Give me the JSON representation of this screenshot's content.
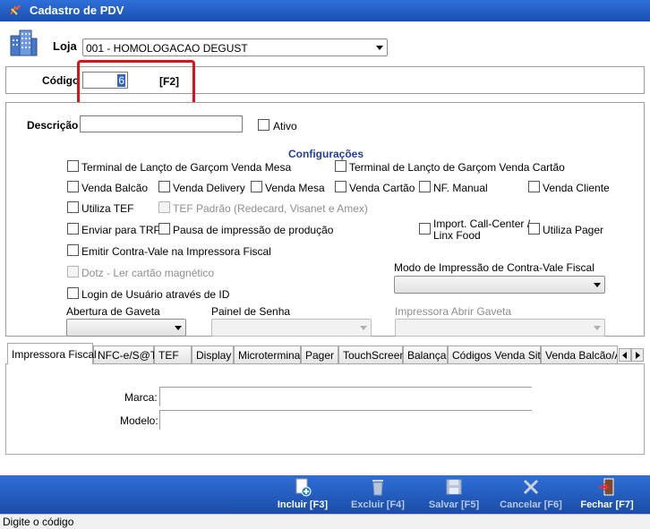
{
  "window": {
    "title": "Cadastro de PDV"
  },
  "loja": {
    "label": "Loja",
    "value": "001 - HOMOLOGACAO DEGUST"
  },
  "codigo": {
    "label": "Código",
    "value": "6",
    "shortcut": "[F2]"
  },
  "descricao": {
    "label": "Descrição",
    "value": ""
  },
  "ativo": {
    "label": "Ativo",
    "checked": false
  },
  "configuracoes": {
    "title": "Configurações",
    "terminal_mesa": "Terminal de Lançto de Garçom Venda Mesa",
    "terminal_cartao": "Terminal de Lançto de Garçom Venda Cartão",
    "venda_balcao": "Venda Balcão",
    "venda_delivery": "Venda Delivery",
    "venda_mesa": "Venda Mesa",
    "venda_cartao": "Venda Cartão",
    "nf_manual": "NF. Manual",
    "venda_cliente": "Venda Cliente",
    "utiliza_tef": "Utiliza TEF",
    "tef_padrao": "TEF Padrão (Redecard, Visanet e Amex)",
    "enviar_trp": "Enviar para TRP",
    "pausa_impressao": "Pausa de impressão de produção",
    "import_call_center": "Import. Call-Center /",
    "import_call_center_2": "Linx Food",
    "utiliza_pager": "Utiliza Pager",
    "emitir_contra_vale": "Emitir Contra-Vale na Impressora Fiscal",
    "dotz": "Dotz - Ler cartão magnético",
    "modo_impressao_label": "Modo de Impressão de Contra-Vale Fiscal",
    "login_usuario": "Login de Usuário através de ID",
    "abertura_gaveta_label": "Abertura de Gaveta",
    "painel_senha_label": "Painel de Senha",
    "impressora_abrir_gaveta_label": "Impressora Abrir Gaveta"
  },
  "tabs": [
    "Impressora Fiscal",
    "NFC-e/S@T",
    "TEF",
    "Display",
    "Microterminal",
    "Pager",
    "TouchScreen",
    "Balança",
    "Códigos Venda Site",
    "Venda Balcão/Au"
  ],
  "impressora_fiscal": {
    "marca_label": "Marca:",
    "modelo_label": "Modelo:"
  },
  "toolbar": {
    "incluir": "Incluir [F3]",
    "excluir": "Excluir [F4]",
    "salvar": "Salvar [F5]",
    "cancelar": "Cancelar [F6]",
    "fechar": "Fechar [F7]"
  },
  "status": "Digite o código",
  "colors": {
    "titlebar": "#2e6fd9",
    "highlight": "#e0101a",
    "config_title": "#1f3f9a"
  }
}
